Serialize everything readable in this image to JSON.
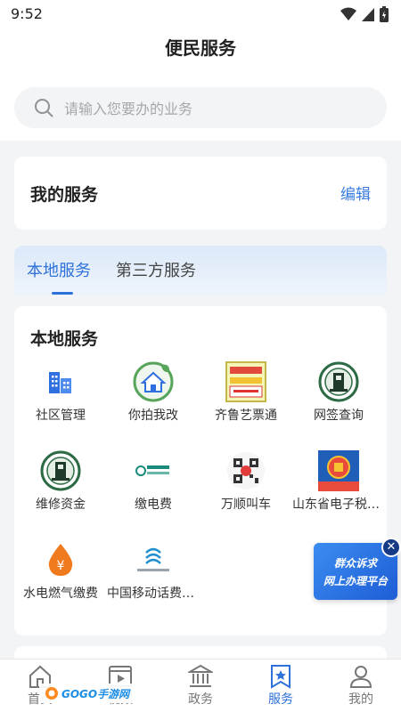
{
  "status": {
    "time": "9:52",
    "icons": [
      "wifi-icon",
      "signal-icon",
      "battery-icon"
    ]
  },
  "header": {
    "title": "便民服务"
  },
  "search": {
    "placeholder": "请输入您要办的业务",
    "icon": "search-icon"
  },
  "my_services": {
    "title": "我的服务",
    "edit_label": "编辑"
  },
  "tabs": [
    {
      "label": "本地服务",
      "active": true
    },
    {
      "label": "第三方服务",
      "active": false
    }
  ],
  "local": {
    "title": "本地服务",
    "items": [
      {
        "label": "社区管理",
        "icon": "buildings-icon"
      },
      {
        "label": "你拍我改",
        "icon": "home-leaf-icon"
      },
      {
        "label": "齐鲁艺票通",
        "icon": "ticket-icon"
      },
      {
        "label": "网签查询",
        "icon": "emblem-icon"
      },
      {
        "label": "维修资金",
        "icon": "emblem-icon"
      },
      {
        "label": "缴电费",
        "icon": "state-grid-icon"
      },
      {
        "label": "万顺叫车",
        "icon": "qr-code-icon"
      },
      {
        "label": "山东省电子税务局",
        "icon": "tax-emblem-icon"
      },
      {
        "label": "水电燃气缴费",
        "icon": "yuan-drop-icon"
      },
      {
        "label": "中国移动话费充值",
        "icon": "china-mobile-icon"
      }
    ]
  },
  "promo": {
    "line1": "群众诉求",
    "line2": "网上办理平台",
    "close_icon": "close-icon"
  },
  "bottom_nav": [
    {
      "label": "首页",
      "icon": "home-icon",
      "active": false
    },
    {
      "label": "视频",
      "icon": "video-icon",
      "active": false
    },
    {
      "label": "政务",
      "icon": "government-icon",
      "active": false
    },
    {
      "label": "服务",
      "icon": "star-bookmark-icon",
      "active": true
    },
    {
      "label": "我的",
      "icon": "user-icon",
      "active": false
    }
  ],
  "colors": {
    "accent": "#2e71d8",
    "edit": "#3a7be0",
    "background": "#f3f4f6"
  }
}
